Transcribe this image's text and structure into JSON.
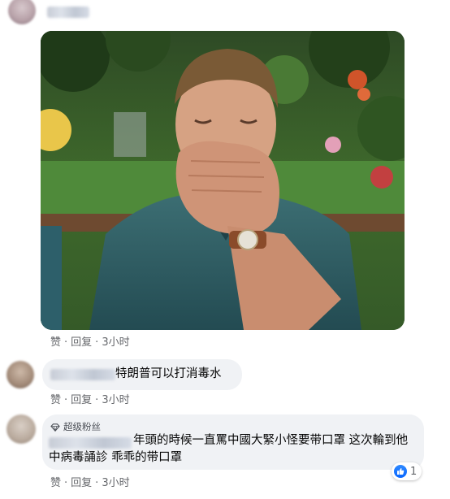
{
  "comments": [
    {
      "actions": {
        "like": "赞",
        "reply": "回复",
        "time": "3小时"
      }
    },
    {
      "text": "特朗普可以打消毒水",
      "actions": {
        "like": "赞",
        "reply": "回复",
        "time": "3小时"
      }
    },
    {
      "badge": "超级粉丝",
      "text": "年頭的時候一直罵中國大緊小怪要带口罩 这次輪到他中病毒誦診 乖乖的带口罩",
      "actions": {
        "like": "赞",
        "reply": "回复",
        "time": "3小时"
      },
      "reaction_count": "1"
    }
  ],
  "separator": "·",
  "colors": {
    "bubble": "#f0f2f5",
    "meta_text": "#65676b",
    "like_blue": "#0866ff"
  }
}
